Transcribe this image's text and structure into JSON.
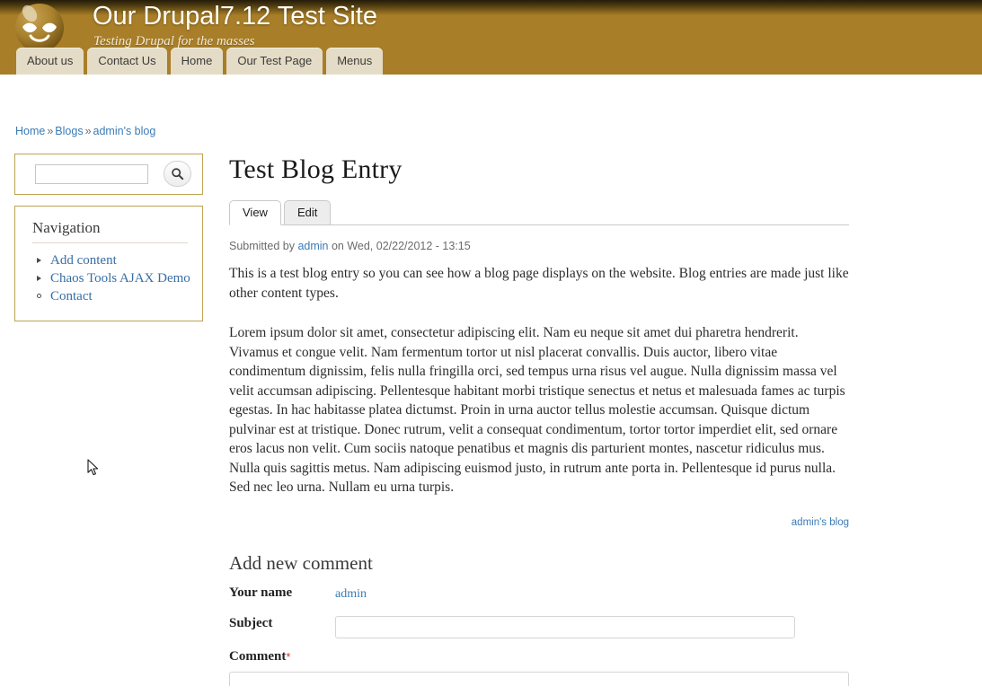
{
  "header": {
    "site_name": "Our Drupal7.12 Test Site",
    "slogan": "Testing Drupal for the masses",
    "logo_icon": "drupal-drop-logo",
    "bg_color": "#A87E28"
  },
  "main_menu": {
    "items": [
      {
        "label": "About us"
      },
      {
        "label": "Contact Us"
      },
      {
        "label": "Home"
      },
      {
        "label": "Our Test Page"
      },
      {
        "label": "Menus"
      }
    ]
  },
  "breadcrumb": {
    "separator": "»",
    "items": [
      {
        "label": "Home"
      },
      {
        "label": "Blogs"
      },
      {
        "label": "admin's blog"
      }
    ]
  },
  "sidebar": {
    "search": {
      "value": "",
      "placeholder": "",
      "button_icon": "search-icon"
    },
    "navigation": {
      "title": "Navigation",
      "items": [
        {
          "label": "Add content",
          "marker": "collapsed"
        },
        {
          "label": "Chaos Tools AJAX Demo",
          "marker": "collapsed"
        },
        {
          "label": "Contact",
          "marker": "leaf"
        }
      ]
    }
  },
  "content": {
    "title": "Test Blog Entry",
    "tabs": [
      {
        "label": "View",
        "active": true
      },
      {
        "label": "Edit",
        "active": false
      }
    ],
    "submitted": {
      "prefix": "Submitted by ",
      "author": "admin",
      "suffix": " on Wed, 02/22/2012 - 13:15"
    },
    "paragraphs": [
      "This is a test blog entry so you can see how a blog page displays on the website. Blog entries are made just like other content types.",
      "Lorem ipsum dolor sit amet, consectetur adipiscing elit. Nam eu neque sit amet dui pharetra hendrerit. Vivamus et congue velit. Nam fermentum tortor ut nisl placerat convallis. Duis auctor, libero vitae condimentum dignissim, felis nulla fringilla orci, sed tempus urna risus vel augue. Nulla dignissim massa vel velit accumsan adipiscing. Pellentesque habitant morbi tristique senectus et netus et malesuada fames ac turpis egestas. In hac habitasse platea dictumst. Proin in urna auctor tellus molestie accumsan. Quisque dictum pulvinar est at tristique. Donec rutrum, velit a consequat condimentum, tortor tortor imperdiet elit, sed ornare eros lacus non velit. Cum sociis natoque penatibus et magnis dis parturient montes, nascetur ridiculus mus. Nulla quis sagittis metus. Nam adipiscing euismod justo, in rutrum ante porta in. Pellentesque id purus nulla. Sed nec leo urna. Nullam eu urna turpis."
    ],
    "blog_link": "admin's blog"
  },
  "comment_form": {
    "title": "Add new comment",
    "your_name_label": "Your name",
    "your_name_value": "admin",
    "subject_label": "Subject",
    "subject_value": "",
    "subject_placeholder": "",
    "comment_label": "Comment",
    "required_mark": "*"
  }
}
